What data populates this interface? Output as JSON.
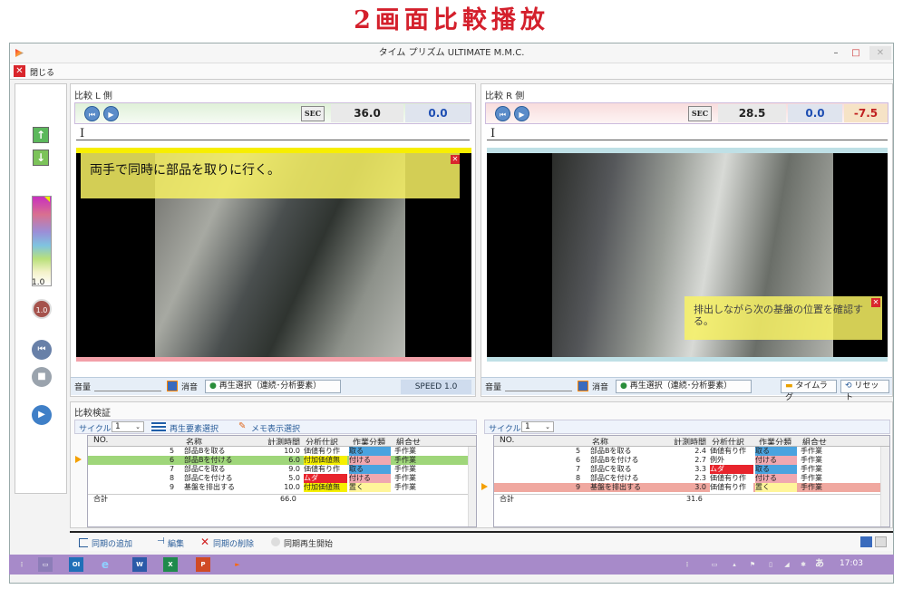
{
  "heading": "2画面比較播放",
  "window": {
    "title": "タイム プリズム ULTIMATE M.M.C.",
    "min": "–",
    "max": "□",
    "close": "✕"
  },
  "menu": {
    "close_label": "閉じる"
  },
  "sidebar": {
    "level": "1.0",
    "speed_badge": "1.0"
  },
  "left": {
    "title": "比較 L 側",
    "sec": "SEC",
    "time": "36.0",
    "offset": "0.0",
    "caption": "両手で同時に部品を取りに行く。",
    "volume": "音量",
    "mute": "消音",
    "play_select": "再生選択（連続･分析要素）",
    "speed": "SPEED 1.0"
  },
  "right": {
    "title": "比較 R 側",
    "sec": "SEC",
    "time": "28.5",
    "offset": "0.0",
    "diff": "-7.5",
    "caption": "排出しながら次の基盤の位置を確認する。",
    "volume": "音量",
    "mute": "消音",
    "play_select": "再生選択（連続･分析要素）",
    "timelag": "タイムラグ",
    "reset": "リセット"
  },
  "verify": {
    "title": "比較検証",
    "cycle_label": "サイクル",
    "left_cycle": "1",
    "right_cycle": "1",
    "elem_select": "再生要素選択",
    "memo_select": "メモ表示選択",
    "columns": [
      "NO.",
      "名称",
      "計測時間",
      "分析仕訳",
      "作業分類",
      "組合せ"
    ],
    "total_label": "合計",
    "left_total": "66.0",
    "right_total": "31.6",
    "left_rows": [
      {
        "no": "5",
        "name": "部品Bを取る",
        "time": "10.0",
        "spec": "価値有り作",
        "cls": "取る",
        "combo": "手作業",
        "spec_color": "#ffffff",
        "cls_color": "#4aa3df"
      },
      {
        "no": "6",
        "name": "部品Bを付ける",
        "time": "6.0",
        "spec": "付加価値無",
        "cls": "付ける",
        "combo": "手作業",
        "spec_color": "#f6f000",
        "cls_color": "#f0a8b0"
      },
      {
        "no": "7",
        "name": "部品Cを取る",
        "time": "9.0",
        "spec": "価値有り作",
        "cls": "取る",
        "combo": "手作業",
        "spec_color": "#ffffff",
        "cls_color": "#4aa3df"
      },
      {
        "no": "8",
        "name": "部品Cを付ける",
        "time": "5.0",
        "spec": "ムダ",
        "cls": "付ける",
        "combo": "手作業",
        "spec_color": "#e8242c",
        "cls_color": "#f0a8b0"
      },
      {
        "no": "9",
        "name": "基盤を排出する",
        "time": "10.0",
        "spec": "付加価値無",
        "cls": "置く",
        "combo": "手作業",
        "spec_color": "#f6f000",
        "cls_color": "#fff59a"
      }
    ],
    "right_rows": [
      {
        "no": "5",
        "name": "部品Bを取る",
        "time": "2.4",
        "spec": "価値有り作",
        "cls": "取る",
        "combo": "手作業",
        "spec_color": "#ffffff",
        "cls_color": "#4aa3df"
      },
      {
        "no": "6",
        "name": "部品Bを付ける",
        "time": "2.7",
        "spec": "例外",
        "cls": "付ける",
        "combo": "手作業",
        "spec_color": "#ffffff",
        "cls_color": "#f0a8b0"
      },
      {
        "no": "7",
        "name": "部品Cを取る",
        "time": "3.3",
        "spec": "ムダ",
        "cls": "取る",
        "combo": "手作業",
        "spec_color": "#e8242c",
        "cls_color": "#4aa3df"
      },
      {
        "no": "8",
        "name": "部品Cを付ける",
        "time": "2.3",
        "spec": "価値有り作",
        "cls": "付ける",
        "combo": "手作業",
        "spec_color": "#ffffff",
        "cls_color": "#f0a8b0"
      },
      {
        "no": "9",
        "name": "基盤を排出する",
        "time": "3.0",
        "spec": "価値有り作",
        "cls": "置く",
        "combo": "手作業",
        "spec_color": "#ffffff",
        "cls_color": "#fff59a"
      }
    ]
  },
  "sync": {
    "add": "同期の追加",
    "edit": "編集",
    "delete": "同期の削除",
    "play": "同期再生開始"
  },
  "taskbar": {
    "time": "17:03",
    "ime": "あ"
  }
}
